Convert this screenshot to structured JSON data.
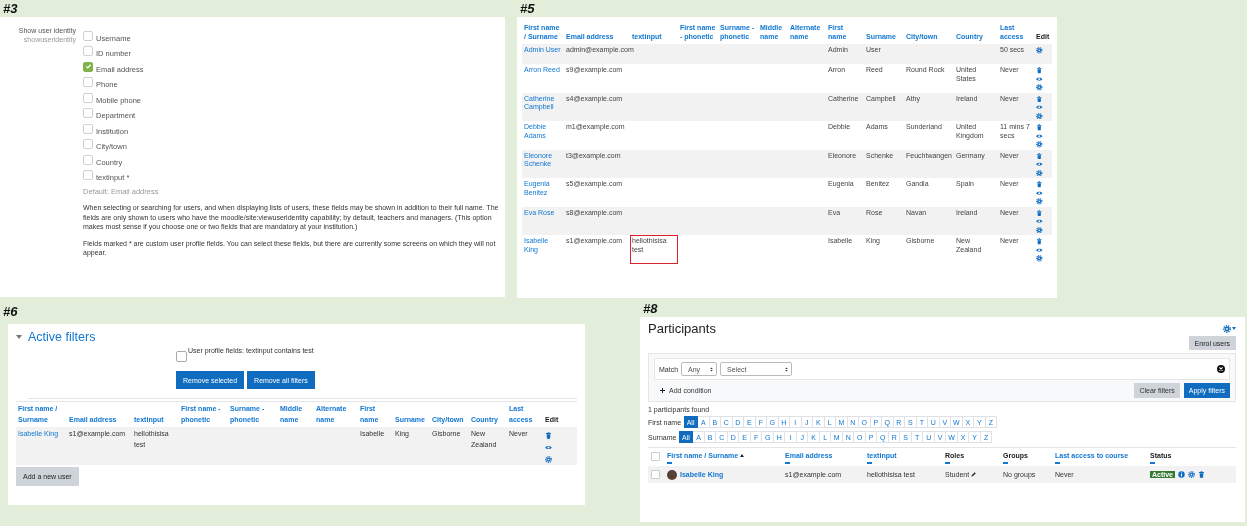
{
  "panel_3": {
    "label": "#3",
    "setting_name": "Show user identity",
    "setting_key": "showuseridentity",
    "options": [
      {
        "label": "Username",
        "checked": false
      },
      {
        "label": "ID number",
        "checked": false
      },
      {
        "label": "Email address",
        "checked": true
      },
      {
        "label": "Phone",
        "checked": false
      },
      {
        "label": "Mobile phone",
        "checked": false
      },
      {
        "label": "Department",
        "checked": false
      },
      {
        "label": "Institution",
        "checked": false
      },
      {
        "label": "City/town",
        "checked": false
      },
      {
        "label": "Country",
        "checked": false
      },
      {
        "label": "textinput *",
        "checked": false
      }
    ],
    "default": "Default: Email address",
    "paragraphs": [
      "When selecting or searching for users, and when displaying lists of users, these fields may be shown in addition to their full name. The fields are only shown to users who have the moodle/site:viewuseridentity capability; by default, teachers and managers. (This option makes most sense if you choose one or two fields that are mandatory at your institution.)",
      "Fields marked * are custom user profile fields. You can select these fields, but there are currently some screens on which they will not appear."
    ]
  },
  "panel_5": {
    "label": "#5",
    "columns": [
      {
        "label": "First name / Surname",
        "sortable": true
      },
      {
        "label": "Email address",
        "sortable": true
      },
      {
        "label": "textinput",
        "sortable": true
      },
      {
        "label": "First name - phonetic",
        "sortable": true
      },
      {
        "label": "Surname - phonetic",
        "sortable": true
      },
      {
        "label": "Middle name",
        "sortable": true
      },
      {
        "label": "Alternate name",
        "sortable": true
      },
      {
        "label": "First name",
        "sortable": true
      },
      {
        "label": "Surname",
        "sortable": true
      },
      {
        "label": "City/town",
        "sortable": true
      },
      {
        "label": "Country",
        "sortable": true
      },
      {
        "label": "Last access",
        "sortable": true
      },
      {
        "label": "Edit",
        "sortable": false
      }
    ],
    "rows": [
      {
        "name": "Admin User",
        "email": "admin@example.com",
        "first_name": "Admin",
        "surname": "User",
        "last_access": "50 secs",
        "actions": [
          {
            "kind": "settings"
          }
        ],
        "textinput_highlighted": false
      },
      {
        "name": "Arron Reed",
        "email": "s9@example.com",
        "first_name": "Arron",
        "surname": "Reed",
        "city": "Round Rock",
        "country": "United States",
        "last_access": "Never",
        "actions": [
          {
            "kind": "delete"
          },
          {
            "kind": "view"
          },
          {
            "kind": "settings"
          }
        ],
        "textinput_highlighted": false
      },
      {
        "name": "Catherine Campbell",
        "email": "s4@example.com",
        "first_name": "Catherine",
        "surname": "Campbell",
        "city": "Athy",
        "country": "Ireland",
        "last_access": "Never",
        "actions": [
          {
            "kind": "delete"
          },
          {
            "kind": "view"
          },
          {
            "kind": "settings"
          }
        ],
        "textinput_highlighted": false
      },
      {
        "name": "Debbie Adams",
        "email": "m1@example.com",
        "first_name": "Debbie",
        "surname": "Adams",
        "city": "Sunderland",
        "country": "United Kingdom",
        "last_access": "11 mins 7 secs",
        "actions": [
          {
            "kind": "delete"
          },
          {
            "kind": "view"
          },
          {
            "kind": "settings"
          }
        ],
        "textinput_highlighted": false
      },
      {
        "name": "Eleonore Schenke",
        "email": "t3@example.com",
        "first_name": "Eleonore",
        "surname": "Schenke",
        "city": "Feuchtwangen",
        "country": "Germany",
        "last_access": "Never",
        "actions": [
          {
            "kind": "delete"
          },
          {
            "kind": "view"
          },
          {
            "kind": "settings"
          }
        ],
        "textinput_highlighted": false
      },
      {
        "name": "Eugenia Benitez",
        "email": "s5@example.com",
        "first_name": "Eugenia",
        "surname": "Benitez",
        "city": "Gandia",
        "country": "Spain",
        "last_access": "Never",
        "actions": [
          {
            "kind": "delete"
          },
          {
            "kind": "view"
          },
          {
            "kind": "settings"
          }
        ],
        "textinput_highlighted": false
      },
      {
        "name": "Eva Rose",
        "email": "s8@example.com",
        "first_name": "Eva",
        "surname": "Rose",
        "city": "Navan",
        "country": "Ireland",
        "last_access": "Never",
        "actions": [
          {
            "kind": "delete"
          },
          {
            "kind": "view"
          },
          {
            "kind": "settings"
          }
        ],
        "textinput_highlighted": false
      },
      {
        "name": "Isabelle King",
        "email": "s1@example.com",
        "textinput": "hellothisisa test",
        "first_name": "Isabelle",
        "surname": "King",
        "city": "Gisborne",
        "country": "New Zealand",
        "last_access": "Never",
        "actions": [
          {
            "kind": "delete"
          },
          {
            "kind": "view"
          },
          {
            "kind": "settings"
          }
        ],
        "textinput_highlighted": true
      }
    ]
  },
  "panel_6": {
    "label": "#6",
    "title": "Active filters",
    "expanded": true,
    "filter": {
      "label": "User profile fields: textinput contains test",
      "checked": false
    },
    "buttons": [
      "Remove selected",
      "Remove all filters"
    ],
    "columns": [
      {
        "label": "First name / Surname",
        "sortable": true
      },
      {
        "label": "Email address",
        "sortable": true
      },
      {
        "label": "textinput",
        "sortable": true
      },
      {
        "label": "First name - phonetic",
        "sortable": true
      },
      {
        "label": "Surname - phonetic",
        "sortable": true
      },
      {
        "label": "Middle name",
        "sortable": true
      },
      {
        "label": "Alternate name",
        "sortable": true
      },
      {
        "label": "First name",
        "sortable": true
      },
      {
        "label": "Surname",
        "sortable": true
      },
      {
        "label": "City/town",
        "sortable": true
      },
      {
        "label": "Country",
        "sortable": true
      },
      {
        "label": "Last access",
        "sortable": true
      },
      {
        "label": "Edit",
        "sortable": false
      }
    ],
    "rows": [
      {
        "name": "Isabelle King",
        "email": "s1@example.com",
        "textinput": "hellothisisa test",
        "first_name": "Isabelle",
        "surname": "King",
        "city": "Gisborne",
        "country": "New Zealand",
        "last_access": "Never",
        "actions": [
          {
            "kind": "delete"
          },
          {
            "kind": "view"
          },
          {
            "kind": "settings"
          }
        ]
      }
    ],
    "add_button": "Add a new user"
  },
  "panel_8": {
    "label": "#8",
    "title": "Participants",
    "enrol_button": "Enrol users",
    "match_label": "Match",
    "match_value": "Any",
    "condition_value": "Select",
    "add_condition": "Add condition",
    "clear_button": "Clear filters",
    "apply_button": "Apply filters",
    "found": "1 participants found",
    "first_name_filter": {
      "label": "First name",
      "letters": [
        {
          "text": "All",
          "selected": true
        },
        {
          "text": "A",
          "selected": false
        },
        {
          "text": "B",
          "selected": false
        },
        {
          "text": "C",
          "selected": false
        },
        {
          "text": "D",
          "selected": false
        },
        {
          "text": "E",
          "selected": false
        },
        {
          "text": "F",
          "selected": false
        },
        {
          "text": "G",
          "selected": false
        },
        {
          "text": "H",
          "selected": false
        },
        {
          "text": "I",
          "selected": false
        },
        {
          "text": "J",
          "selected": false
        },
        {
          "text": "K",
          "selected": false
        },
        {
          "text": "L",
          "selected": false
        },
        {
          "text": "M",
          "selected": false
        },
        {
          "text": "N",
          "selected": false
        },
        {
          "text": "O",
          "selected": false
        },
        {
          "text": "P",
          "selected": false
        },
        {
          "text": "Q",
          "selected": false
        },
        {
          "text": "R",
          "selected": false
        },
        {
          "text": "S",
          "selected": false
        },
        {
          "text": "T",
          "selected": false
        },
        {
          "text": "U",
          "selected": false
        },
        {
          "text": "V",
          "selected": false
        },
        {
          "text": "W",
          "selected": false
        },
        {
          "text": "X",
          "selected": false
        },
        {
          "text": "Y",
          "selected": false
        },
        {
          "text": "Z",
          "selected": false
        }
      ]
    },
    "surname_filter": {
      "label": "Surname",
      "letters": [
        {
          "text": "All",
          "selected": true
        },
        {
          "text": "A",
          "selected": false
        },
        {
          "text": "B",
          "selected": false
        },
        {
          "text": "C",
          "selected": false
        },
        {
          "text": "D",
          "selected": false
        },
        {
          "text": "E",
          "selected": false
        },
        {
          "text": "F",
          "selected": false
        },
        {
          "text": "G",
          "selected": false
        },
        {
          "text": "H",
          "selected": false
        },
        {
          "text": "I",
          "selected": false
        },
        {
          "text": "J",
          "selected": false
        },
        {
          "text": "K",
          "selected": false
        },
        {
          "text": "L",
          "selected": false
        },
        {
          "text": "M",
          "selected": false
        },
        {
          "text": "N",
          "selected": false
        },
        {
          "text": "O",
          "selected": false
        },
        {
          "text": "P",
          "selected": false
        },
        {
          "text": "Q",
          "selected": false
        },
        {
          "text": "R",
          "selected": false
        },
        {
          "text": "S",
          "selected": false
        },
        {
          "text": "T",
          "selected": false
        },
        {
          "text": "U",
          "selected": false
        },
        {
          "text": "V",
          "selected": false
        },
        {
          "text": "W",
          "selected": false
        },
        {
          "text": "X",
          "selected": false
        },
        {
          "text": "Y",
          "selected": false
        },
        {
          "text": "Z",
          "selected": false
        }
      ]
    },
    "select_all_checked": false,
    "columns": [
      {
        "label": "First name / Surname",
        "sortable": true,
        "sorted": true
      },
      {
        "label": "Email address",
        "sortable": true,
        "sorted": false
      },
      {
        "label": "textinput",
        "sortable": true,
        "sorted": false
      },
      {
        "label": "Roles",
        "sortable": false,
        "sorted": false
      },
      {
        "label": "Groups",
        "sortable": false,
        "sorted": false
      },
      {
        "label": "Last access to course",
        "sortable": true,
        "sorted": false
      },
      {
        "label": "Status",
        "sortable": false,
        "sorted": false
      }
    ],
    "rows": [
      {
        "checked": false,
        "name": "Isabelle King",
        "email": "s1@example.com",
        "textinput": "hellothisisa test",
        "role": "Student",
        "groups": "No groups",
        "last_access": "Never",
        "status": "Active",
        "actions": [
          {
            "kind": "info"
          },
          {
            "kind": "settings"
          },
          {
            "kind": "delete"
          }
        ]
      }
    ]
  }
}
